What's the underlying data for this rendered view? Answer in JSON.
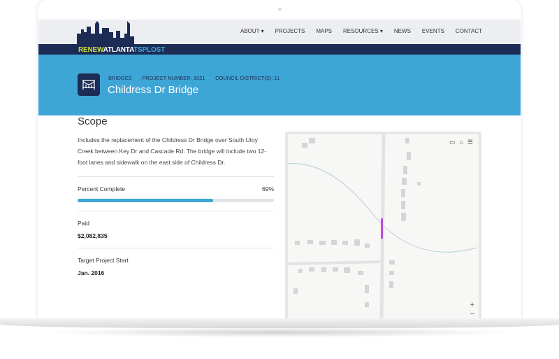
{
  "logo": {
    "part1": "RENEW",
    "part2": "ATLANTA",
    "part3": "TSPLOST"
  },
  "nav": [
    "ABOUT ▾",
    "PROJECTS",
    "MAPS",
    "RESOURCES ▾",
    "NEWS",
    "EVENTS",
    "CONTACT"
  ],
  "hero": {
    "category": "BRIDGES",
    "project_number": "PROJECT NUMBER: 1021",
    "district": "COUNCIL DISTRICT(S): 11",
    "title": "Childress Dr Bridge"
  },
  "scope": {
    "heading": "Scope",
    "description": "Includes the replacement of the Childress Dr Bridge over South Utoy Creek between Key Dr and Cascade Rd. The bridge will include two 12-foot lanes and sidewalk on the east side of Childress Dr."
  },
  "progress": {
    "label": "Percent Complete",
    "value_text": "69%",
    "percent": 69
  },
  "paid": {
    "label": "Paid",
    "value": "$2,082,835"
  },
  "start": {
    "label": "Target Project Start",
    "value": "Jan. 2016"
  },
  "map": {
    "zoom_in": "+",
    "zoom_out": "−",
    "highlight_color": "#b84be0"
  }
}
